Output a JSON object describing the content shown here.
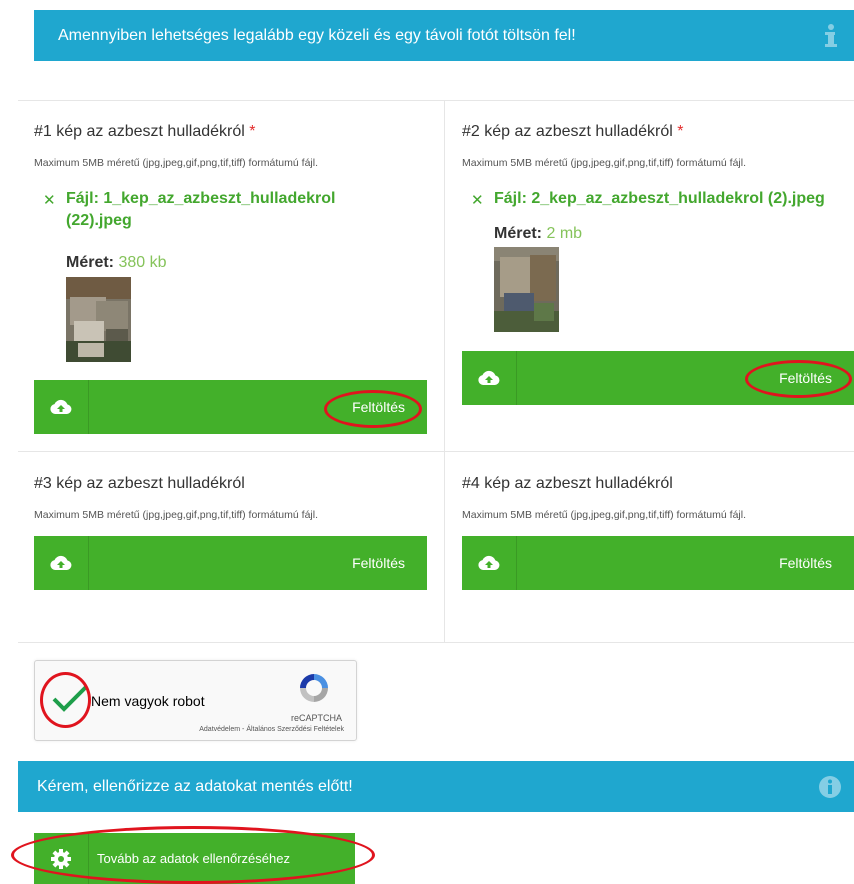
{
  "info_banner": {
    "text": "Amennyiben lehetséges legalább egy közeli és egy távoli fotót töltsön fel!",
    "icon": "info-icon"
  },
  "slots": [
    {
      "title": "#1 kép az azbeszt hulladékról",
      "required_mark": "*",
      "hint": "Maximum 5MB méretű (jpg,jpeg,gif,png,tif,tiff) formátumú fájl.",
      "file_prefix": "Fájl:",
      "file_name_line1": "1_kep_az_azbeszt_hulladekrol",
      "file_name_line2": "(22).jpeg",
      "size_label": "Méret:",
      "size_value": "380 kb",
      "upload_label": "Feltöltés"
    },
    {
      "title": "#2 kép az azbeszt hulladékról",
      "required_mark": "*",
      "hint": "Maximum 5MB méretű (jpg,jpeg,gif,png,tif,tiff) formátumú fájl.",
      "file_prefix": "Fájl:",
      "file_name_line1": "2_kep_az_azbeszt_hulladekrol (2).jpeg",
      "size_label": "Méret:",
      "size_value": "2 mb",
      "upload_label": "Feltöltés"
    },
    {
      "title": "#3 kép az azbeszt hulladékról",
      "hint": "Maximum 5MB méretű (jpg,jpeg,gif,png,tif,tiff) formátumú fájl.",
      "upload_label": "Feltöltés"
    },
    {
      "title": "#4 kép az azbeszt hulladékról",
      "hint": "Maximum 5MB méretű (jpg,jpeg,gif,png,tif,tiff) formátumú fájl.",
      "upload_label": "Feltöltés"
    }
  ],
  "recaptcha": {
    "label": "Nem vagyok robot",
    "brand": "reCAPTCHA",
    "links": "Adatvédelem - Általános Szerződési Feltételek",
    "checked": true
  },
  "check_banner": {
    "text": "Kérem, ellenőrizze az adatokat mentés előtt!"
  },
  "next_button": {
    "label": "Tovább az adatok ellenőrzéséhez"
  },
  "colors": {
    "info_blue": "#1fa7cf",
    "button_green": "#43b02a",
    "file_green": "#43a72e",
    "required_red": "#e32b2b",
    "annotation_red": "#e0141e"
  }
}
